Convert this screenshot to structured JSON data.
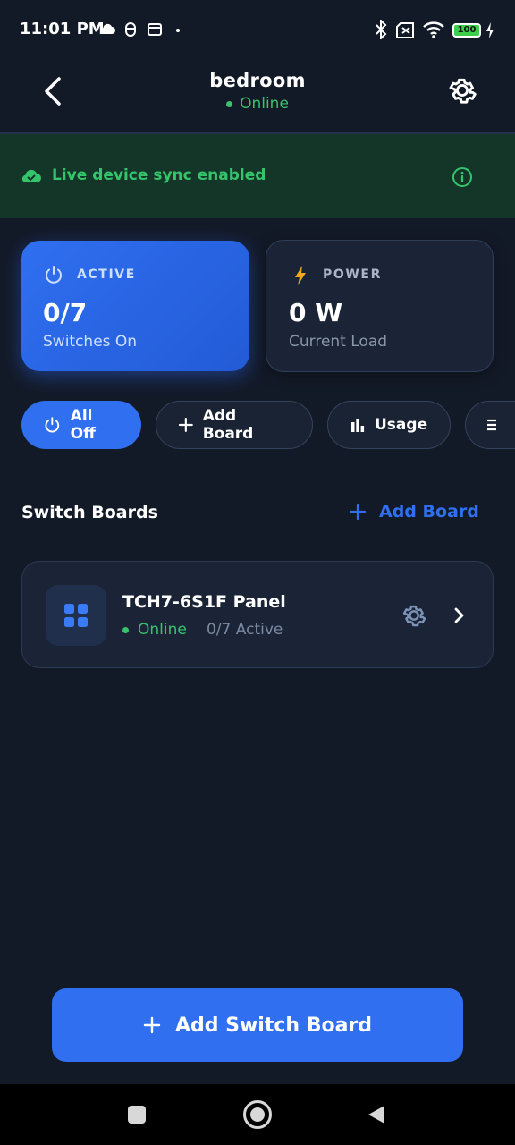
{
  "status_bar": {
    "time": "11:01 PM",
    "battery": "100",
    "icons": [
      "cloud-icon",
      "mouse-icon",
      "calendar-icon",
      "dot-icon",
      "bluetooth-icon",
      "no-sim-icon",
      "wifi-icon",
      "battery-icon",
      "charging-icon"
    ]
  },
  "header": {
    "title": "bedroom",
    "status": "Online",
    "status_color": "#3ac26a"
  },
  "banner": {
    "text": "Live device sync enabled",
    "color": "#34c46b"
  },
  "stats": {
    "active": {
      "label": "ACTIVE",
      "value": "0/7",
      "sub": "Switches On",
      "icon": "power-icon"
    },
    "power": {
      "label": "POWER",
      "value": "0 W",
      "sub": "Current Load",
      "icon": "bolt-icon"
    }
  },
  "chips": [
    {
      "label": "All Off",
      "icon": "power-icon"
    },
    {
      "label": "Add Board",
      "icon": "plus-icon"
    },
    {
      "label": "Usage",
      "icon": "bar-chart-icon"
    },
    {
      "label": "",
      "icon": "list-icon"
    }
  ],
  "section": {
    "title": "Switch Boards",
    "add_label": "Add Board"
  },
  "boards": [
    {
      "name": "TCH7-6S1F Panel",
      "status": "Online",
      "active": "0/7 Active"
    }
  ],
  "bottom_button": {
    "label": "Add Switch Board"
  },
  "colors": {
    "accent": "#2f6ff0",
    "background": "#131a27",
    "online": "#3ac26a",
    "power_bolt": "#f5a524"
  }
}
